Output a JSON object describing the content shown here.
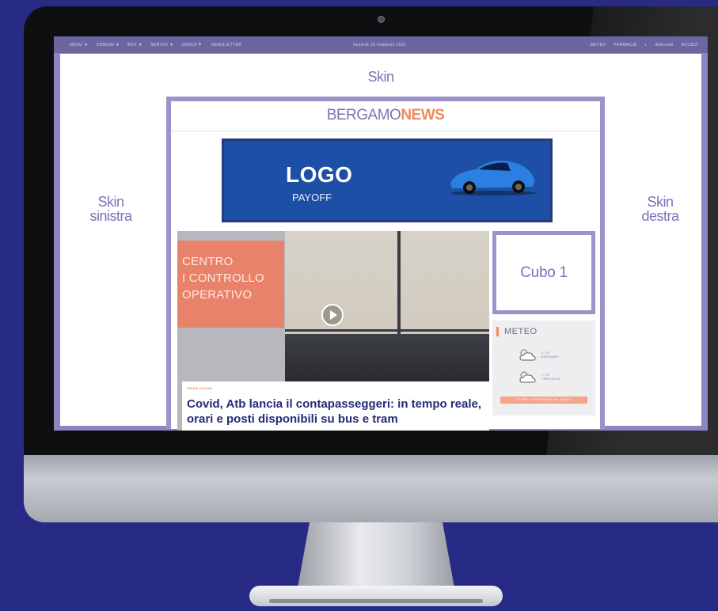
{
  "topbar": {
    "menu": [
      "MENU ▼",
      "COMUNI ▼",
      "BGY ▼",
      "SERVIZI ▼",
      "CERCA 🔍",
      "NEWSLETTER"
    ],
    "date": "Venerdì 26 Febbraio 2021",
    "right": [
      "METEO",
      "FARMACIE",
      "◐",
      "Abbonati",
      "ACCEDI"
    ]
  },
  "skins": {
    "top": "Skin",
    "left_line1": "Skin",
    "left_line2": "sinistra",
    "right_line1": "Skin",
    "right_line2": "destra"
  },
  "brand": {
    "part1": "BERGAMO",
    "part2": "NEWS"
  },
  "banner": {
    "logo": "LOGO",
    "payoff": "PAYOFF"
  },
  "hero": {
    "tag_lines": [
      "CENTRO",
      "I CONTROLLO",
      "OPERATIVO"
    ],
    "category": "PRIMA PAGINA",
    "title": "Covid, Atb lancia il contapasseggeri: in tempo reale, orari e posti disponibili su bus e tram"
  },
  "cubo": "Cubo 1",
  "meteo": {
    "title": "METEO",
    "rows": [
      {
        "city": "BERGAMO",
        "temp": "4° 14°"
      },
      {
        "city": "TREVIGLIO",
        "temp": "4° 13°"
      }
    ],
    "button": "SCOPRI LE PREVISIONI DEL MONDO"
  },
  "colors": {
    "background": "#282b85",
    "skin_frame": "#9a94c9",
    "accent_orange": "#ef8a5a",
    "brand_purple": "#7a74b7"
  }
}
